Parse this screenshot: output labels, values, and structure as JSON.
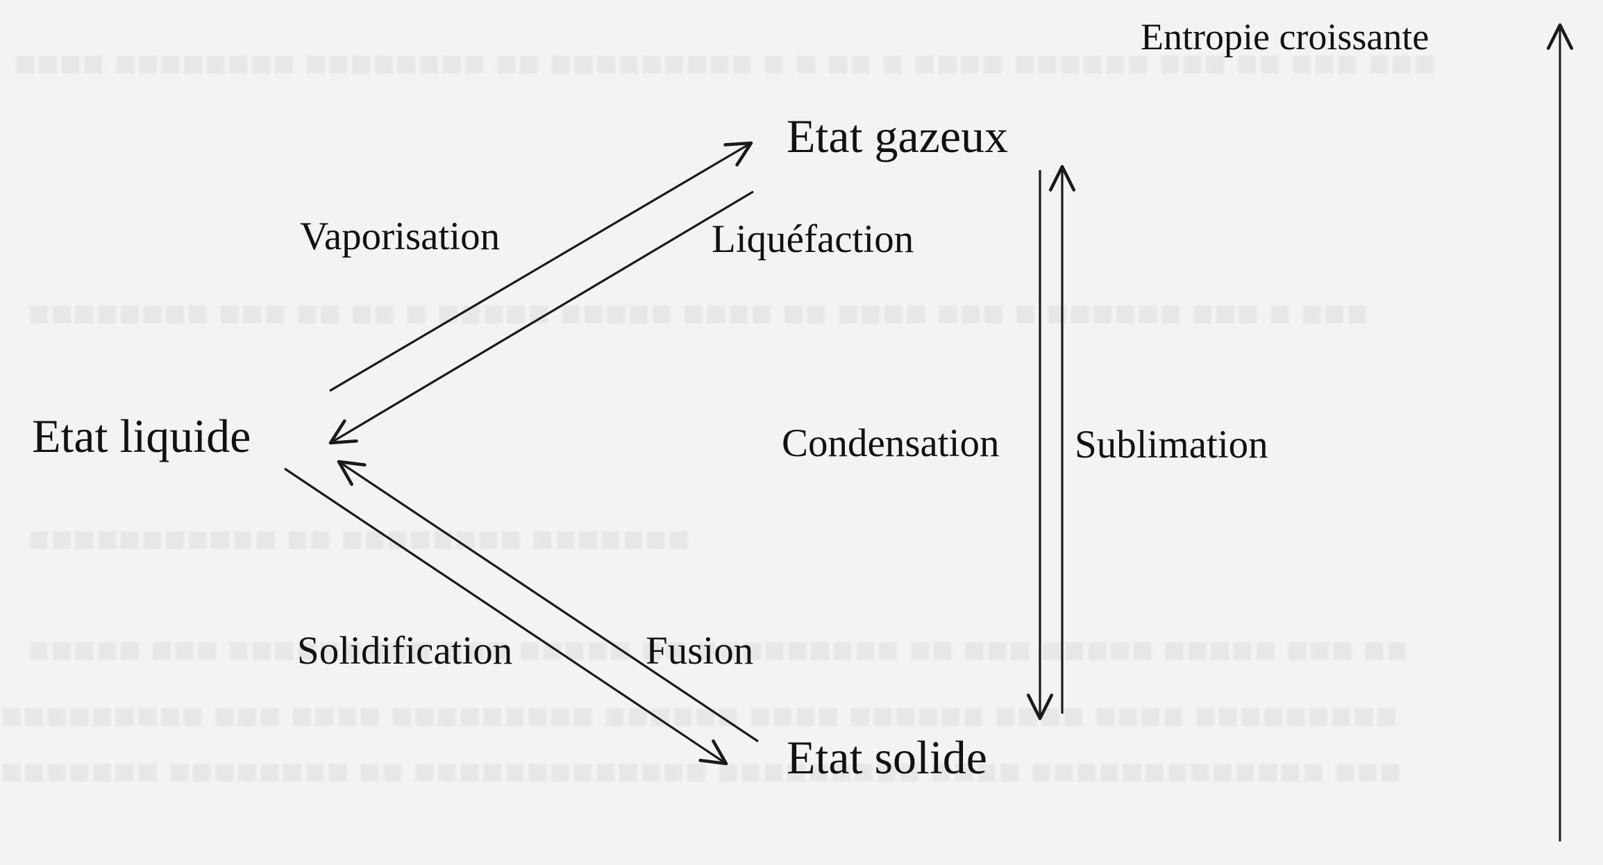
{
  "states": {
    "gaseous": "Etat gazeux",
    "liquid": "Etat liquide",
    "solid": "Etat solide"
  },
  "transitions": {
    "vaporisation": "Vaporisation",
    "liquefaction": "Liquéfaction",
    "solidification": "Solidification",
    "fusion": "Fusion",
    "condensation": "Condensation",
    "sublimation": "Sublimation"
  },
  "entropy_axis": {
    "label": "Entropie croissante",
    "icon": "arrow-up-icon"
  },
  "colors": {
    "ink": "#111111",
    "arrow": "#1a1a1a",
    "paper": "#f3f3f1"
  }
}
